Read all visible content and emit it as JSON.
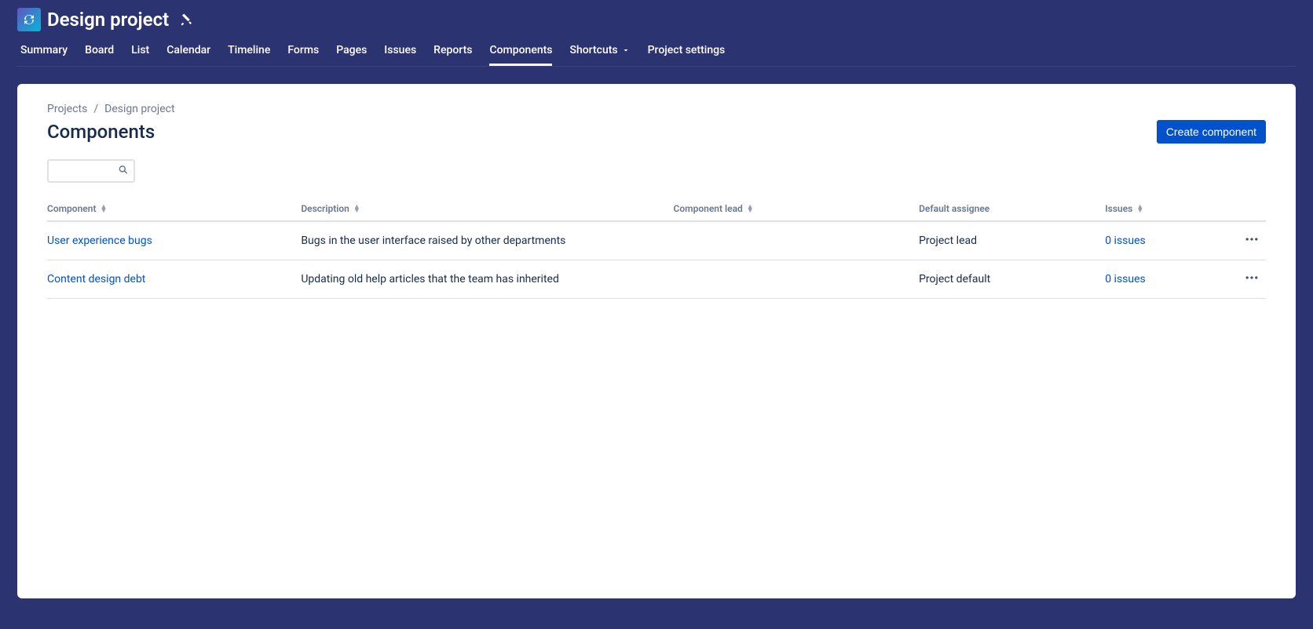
{
  "project": {
    "title": "Design project"
  },
  "nav": {
    "items": [
      {
        "label": "Summary"
      },
      {
        "label": "Board"
      },
      {
        "label": "List"
      },
      {
        "label": "Calendar"
      },
      {
        "label": "Timeline"
      },
      {
        "label": "Forms"
      },
      {
        "label": "Pages"
      },
      {
        "label": "Issues"
      },
      {
        "label": "Reports"
      },
      {
        "label": "Components",
        "active": true
      },
      {
        "label": "Shortcuts",
        "dropdown": true
      },
      {
        "label": "Project settings"
      }
    ]
  },
  "breadcrumb": {
    "projects": "Projects",
    "current": "Design project"
  },
  "page": {
    "title": "Components",
    "create_button": "Create component"
  },
  "search": {
    "value": ""
  },
  "table": {
    "headers": {
      "component": "Component",
      "description": "Description",
      "lead": "Component lead",
      "assignee": "Default assignee",
      "issues": "Issues"
    },
    "rows": [
      {
        "name": "User experience bugs",
        "description": "Bugs in the user interface raised by other departments",
        "lead": "",
        "assignee": "Project lead",
        "issues": "0 issues"
      },
      {
        "name": "Content design debt",
        "description": "Updating old help articles that the team has inherited",
        "lead": "",
        "assignee": "Project default",
        "issues": "0 issues"
      }
    ]
  }
}
